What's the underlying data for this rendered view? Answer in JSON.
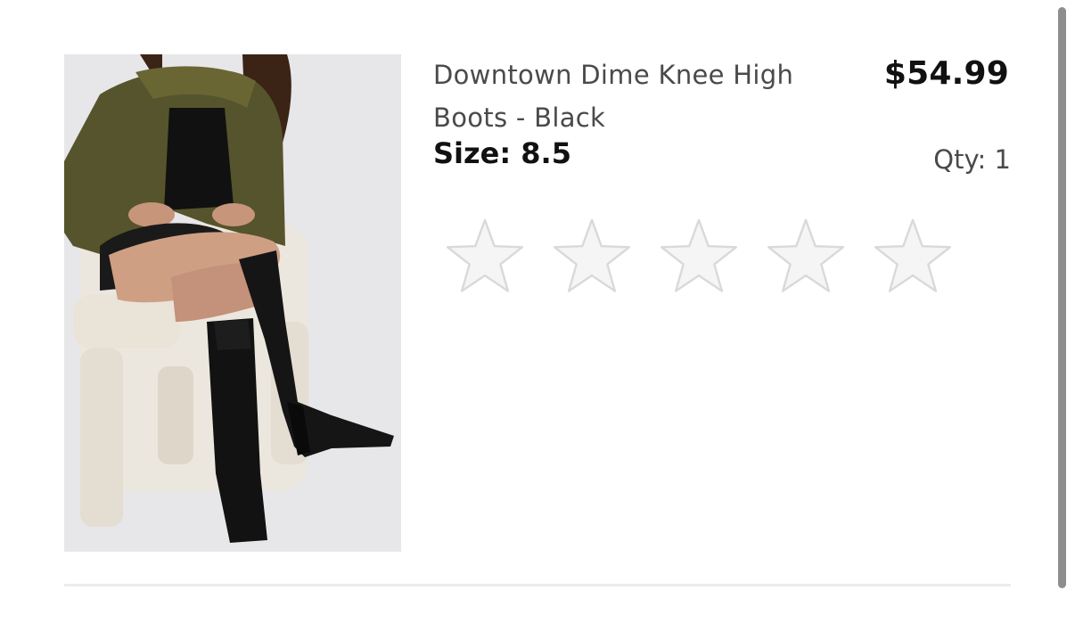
{
  "product": {
    "title": "Downtown Dime Knee High Boots - Black",
    "price": "$54.99",
    "size_label": "Size:",
    "size_value": "8.5",
    "qty_text": "Qty: 1",
    "image_alt": "model wearing knee high boots",
    "rating": {
      "max": 5,
      "value": 0,
      "star_icons": [
        "star-outline-icon",
        "star-outline-icon",
        "star-outline-icon",
        "star-outline-icon",
        "star-outline-icon"
      ]
    }
  },
  "colors": {
    "star_fill": "#f5f5f5",
    "star_stroke": "#d9d9d9",
    "price": "#111111",
    "title": "#4a4a4a"
  }
}
